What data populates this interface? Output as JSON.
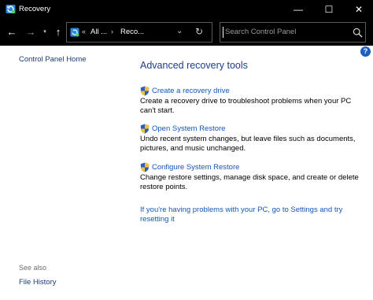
{
  "window": {
    "title": "Recovery",
    "minimize_glyph": "—",
    "maximize_glyph": "☐",
    "close_glyph": "✕"
  },
  "navigation": {
    "back_glyph": "←",
    "forward_glyph": "→",
    "recent_glyph": "▾",
    "up_glyph": "↑"
  },
  "address_bar": {
    "overflow_glyph": "«",
    "segments": [
      "All ...",
      "Reco..."
    ],
    "separator": "›",
    "dropdown_glyph": "⌄",
    "refresh_glyph": "↻"
  },
  "search": {
    "placeholder": "Search Control Panel"
  },
  "sidebar": {
    "home_link": "Control Panel Home",
    "see_also_label": "See also",
    "see_also_items": [
      "File History"
    ]
  },
  "help": {
    "glyph": "?"
  },
  "main": {
    "title": "Advanced recovery tools",
    "tasks": [
      {
        "link": "Create a recovery drive",
        "description": "Create a recovery drive to troubleshoot problems when your PC can't start."
      },
      {
        "link": "Open System Restore",
        "description": "Undo recent system changes, but leave files such as documents, pictures, and music unchanged."
      },
      {
        "link": "Configure System Restore",
        "description": "Change restore settings, manage disk space, and create or delete restore points."
      }
    ],
    "settings_link": "If you're having problems with your PC, go to Settings and try resetting it"
  },
  "icons": {
    "app": "recovery-icon",
    "shield": "uac-shield-icon",
    "search": "search-icon"
  },
  "colors": {
    "titlebar_bg": "#000000",
    "link": "#1556b8",
    "heading": "#1e3d8f",
    "help": "#1f5fbf"
  }
}
